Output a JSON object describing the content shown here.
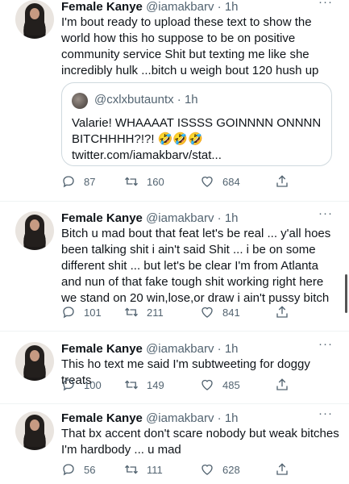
{
  "tweets": [
    {
      "name": "Female Kanye",
      "handle": "@iamakbarv",
      "time": "· 1h",
      "text": "I'm bout ready to upload these text to show the world how this ho suppose to be on positive community service Shit but texting me like she incredibly hulk ...bitch u weigh bout 120 hush up",
      "quote": {
        "handle": "@cxlxbutauntx",
        "time": "· 1h",
        "text": "Valarie! WHAAAAT ISSSS GOINNNN ONNNN BITCHHHH?!?! 🤣🤣🤣 twitter.com/iamakbarv/stat..."
      },
      "replies": "87",
      "retweets": "160",
      "likes": "684"
    },
    {
      "name": "Female Kanye",
      "handle": "@iamakbarv",
      "time": "· 1h",
      "text": "Bitch u mad bout that feat let's be real ... y'all hoes been talking shit i ain't said Shit ... i be on some different shit ... but let's be clear I'm from Atlanta and nun of that fake tough shit working right here we stand on 20 win,lose,or draw i ain't pussy bitch",
      "replies": "101",
      "retweets": "211",
      "likes": "841"
    },
    {
      "name": "Female Kanye",
      "handle": "@iamakbarv",
      "time": "· 1h",
      "text": "This ho text me said I'm subtweeting for doggy treats",
      "replies": "100",
      "retweets": "149",
      "likes": "485"
    },
    {
      "name": "Female Kanye",
      "handle": "@iamakbarv",
      "time": "· 1h",
      "text": "That bx accent don't scare nobody but weak bitches I'm hardbody ... u mad",
      "replies": "56",
      "retweets": "111",
      "likes": "628"
    }
  ],
  "more_label": "···",
  "icons": {
    "reply": "reply-icon",
    "retweet": "retweet-icon",
    "like": "like-icon",
    "share": "share-icon"
  }
}
